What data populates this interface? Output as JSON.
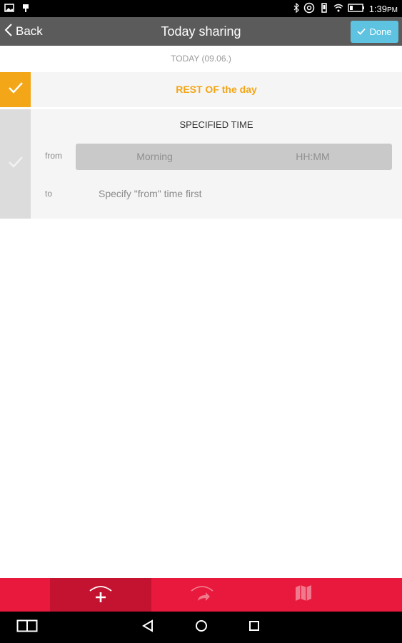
{
  "status_bar": {
    "time": "1:39",
    "time_suffix": "PM",
    "icons": [
      "image-icon",
      "android-icon",
      "bluetooth-icon",
      "at-icon",
      "vibrate-icon",
      "wifi-icon",
      "battery-icon"
    ]
  },
  "header": {
    "back_label": "Back",
    "title": "Today sharing",
    "done_label": "Done"
  },
  "date_label": "TODAY (09.06.)",
  "options": {
    "rest_of_day": {
      "label": "REST OF the day",
      "selected": true
    },
    "specified_time": {
      "title": "SPECIFIED TIME",
      "selected": false,
      "from_label": "from",
      "from_period": "Morning",
      "from_time_placeholder": "HH:MM",
      "to_label": "to",
      "to_hint": "Specify \"from\" time first"
    }
  },
  "bottom_tabs": [
    {
      "icon": "add-share-icon",
      "active": true
    },
    {
      "icon": "forward-share-icon",
      "active": false
    },
    {
      "icon": "map-icon",
      "active": false
    }
  ],
  "nav_bar": {
    "buttons": [
      "recents-split-icon",
      "back-triangle-icon",
      "home-circle-icon",
      "overview-square-icon"
    ]
  },
  "colors": {
    "accent_orange": "#f3a617",
    "header_gray": "#5b5b5b",
    "done_blue": "#5ec3e0",
    "tab_red": "#e8193c",
    "tab_red_active": "#c41331"
  }
}
